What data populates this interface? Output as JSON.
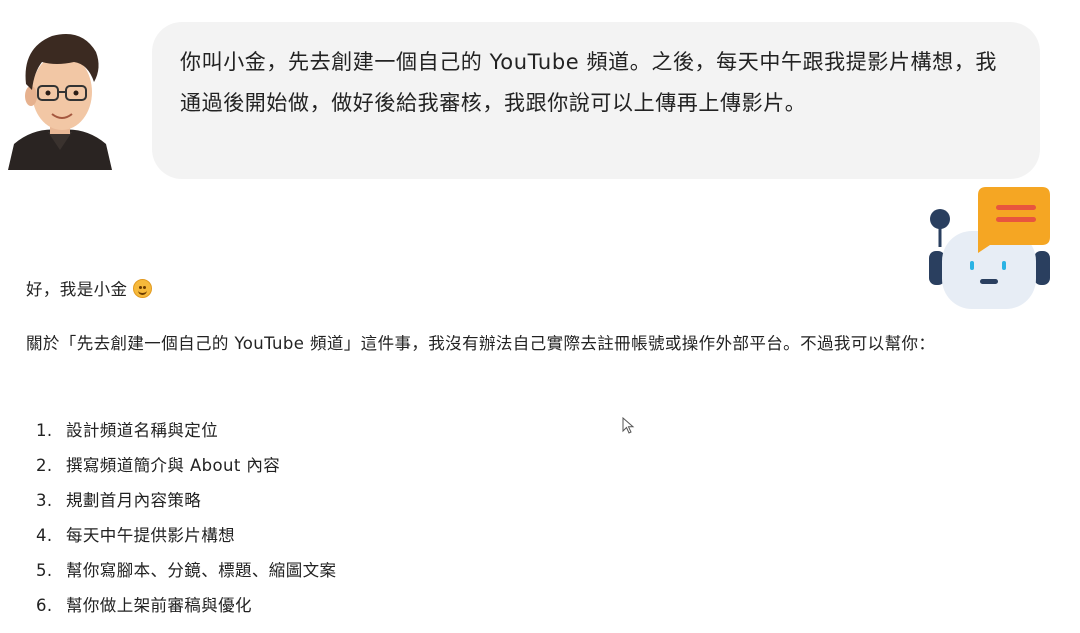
{
  "user_message": {
    "text": "你叫小金，先去創建一個自己的 YouTube 頻道。之後，每天中午跟我提影片構想，我通過後開始做，做好後給我審核，我跟你說可以上傳再上傳影片。"
  },
  "assistant_message": {
    "greeting": "好，我是小金",
    "emoji": "smiling-face-icon",
    "intro": "關於「先去創建一個自己的 YouTube 頻道」這件事，我沒有辦法自己實際去註冊帳號或操作外部平台。不過我可以幫你：",
    "steps": [
      {
        "num": "1.",
        "text": "設計頻道名稱與定位"
      },
      {
        "num": "2.",
        "text": "撰寫頻道簡介與 About 內容"
      },
      {
        "num": "3.",
        "text": "規劃首月內容策略"
      },
      {
        "num": "4.",
        "text": "每天中午提供影片構想"
      },
      {
        "num": "5.",
        "text": "幫你寫腳本、分鏡、標題、縮圖文案"
      },
      {
        "num": "6.",
        "text": "幫你做上架前審稿與優化"
      }
    ]
  },
  "colors": {
    "bubble_bg": "#f3f3f3",
    "bot_body": "#e7edf5",
    "bot_dark": "#2a3f5f",
    "bot_bubble_orange": "#f5a623",
    "bot_bubble_lines": "#e8553e"
  }
}
